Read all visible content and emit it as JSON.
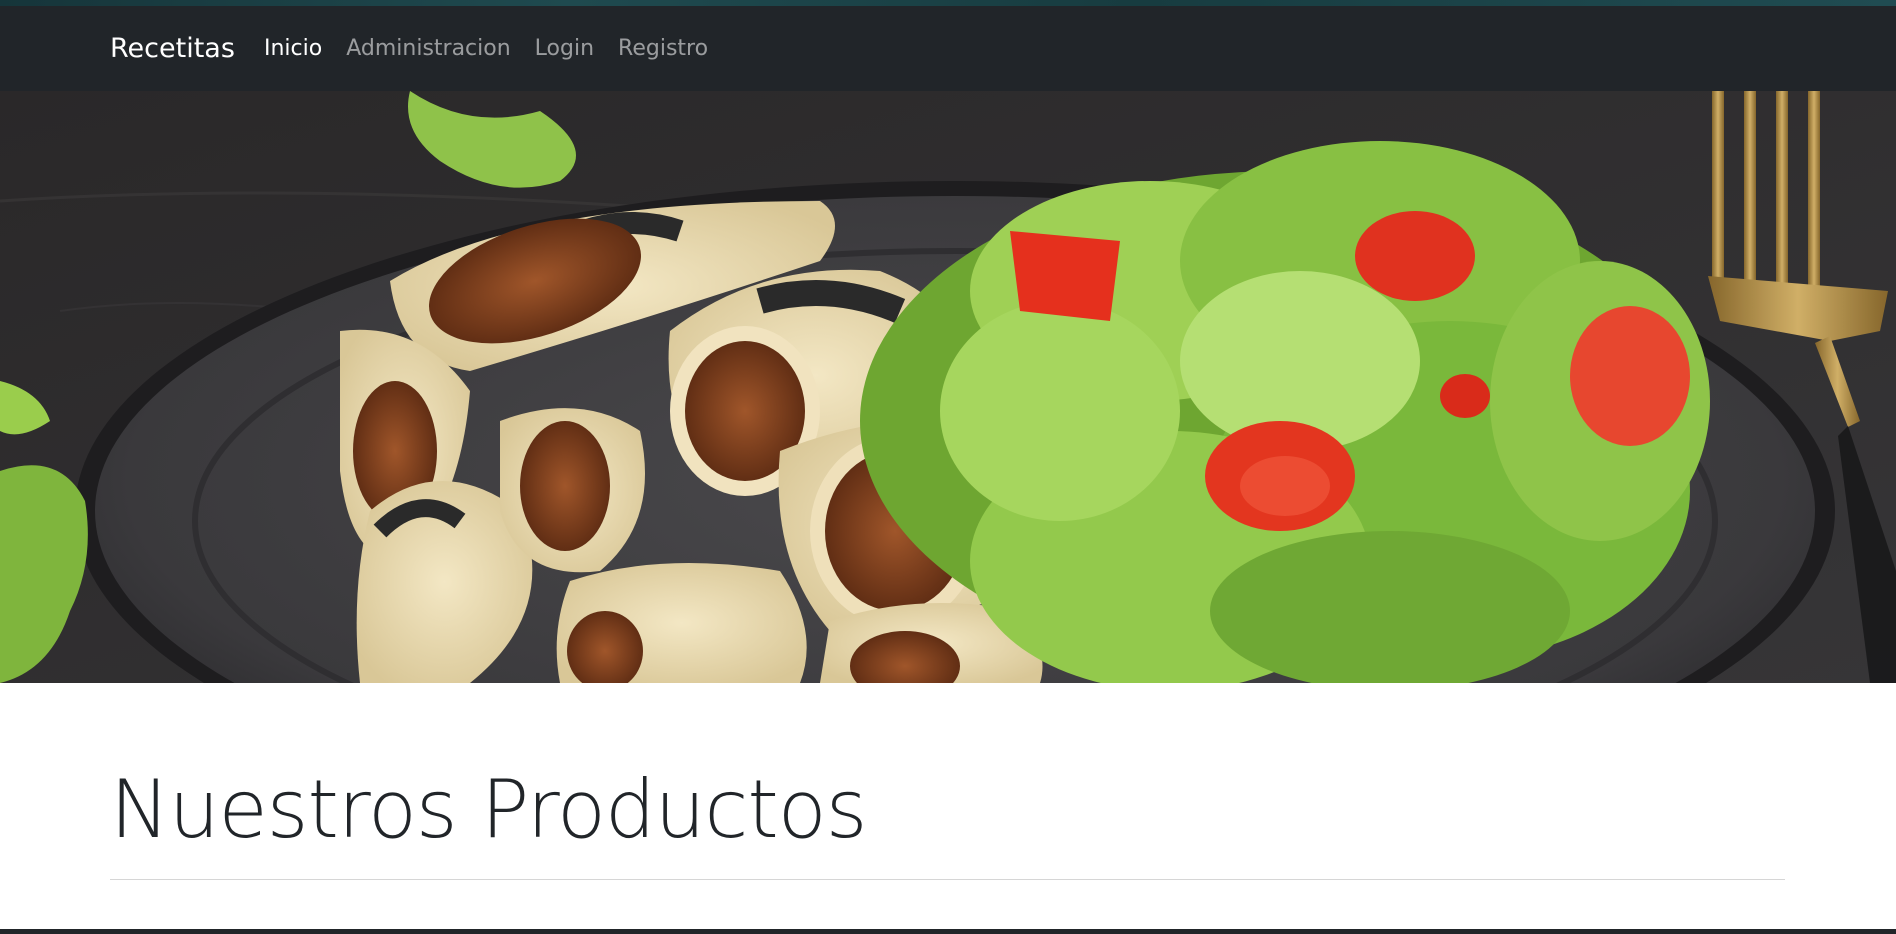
{
  "navbar": {
    "brand": "Recetitas",
    "links": [
      {
        "label": "Inicio",
        "active": true
      },
      {
        "label": "Administracion",
        "active": false
      },
      {
        "label": "Login",
        "active": false
      },
      {
        "label": "Registro",
        "active": false
      }
    ]
  },
  "hero": {
    "image_subject": "plate of stuffed crepes with fresh lettuce and tomato salad, gold fork on dark table"
  },
  "main": {
    "title": "Nuestros Productos"
  },
  "colors": {
    "navbar_bg": "#212529",
    "nav_link": "#8c8f93",
    "nav_link_active": "#ffffff",
    "title": "#212529"
  }
}
